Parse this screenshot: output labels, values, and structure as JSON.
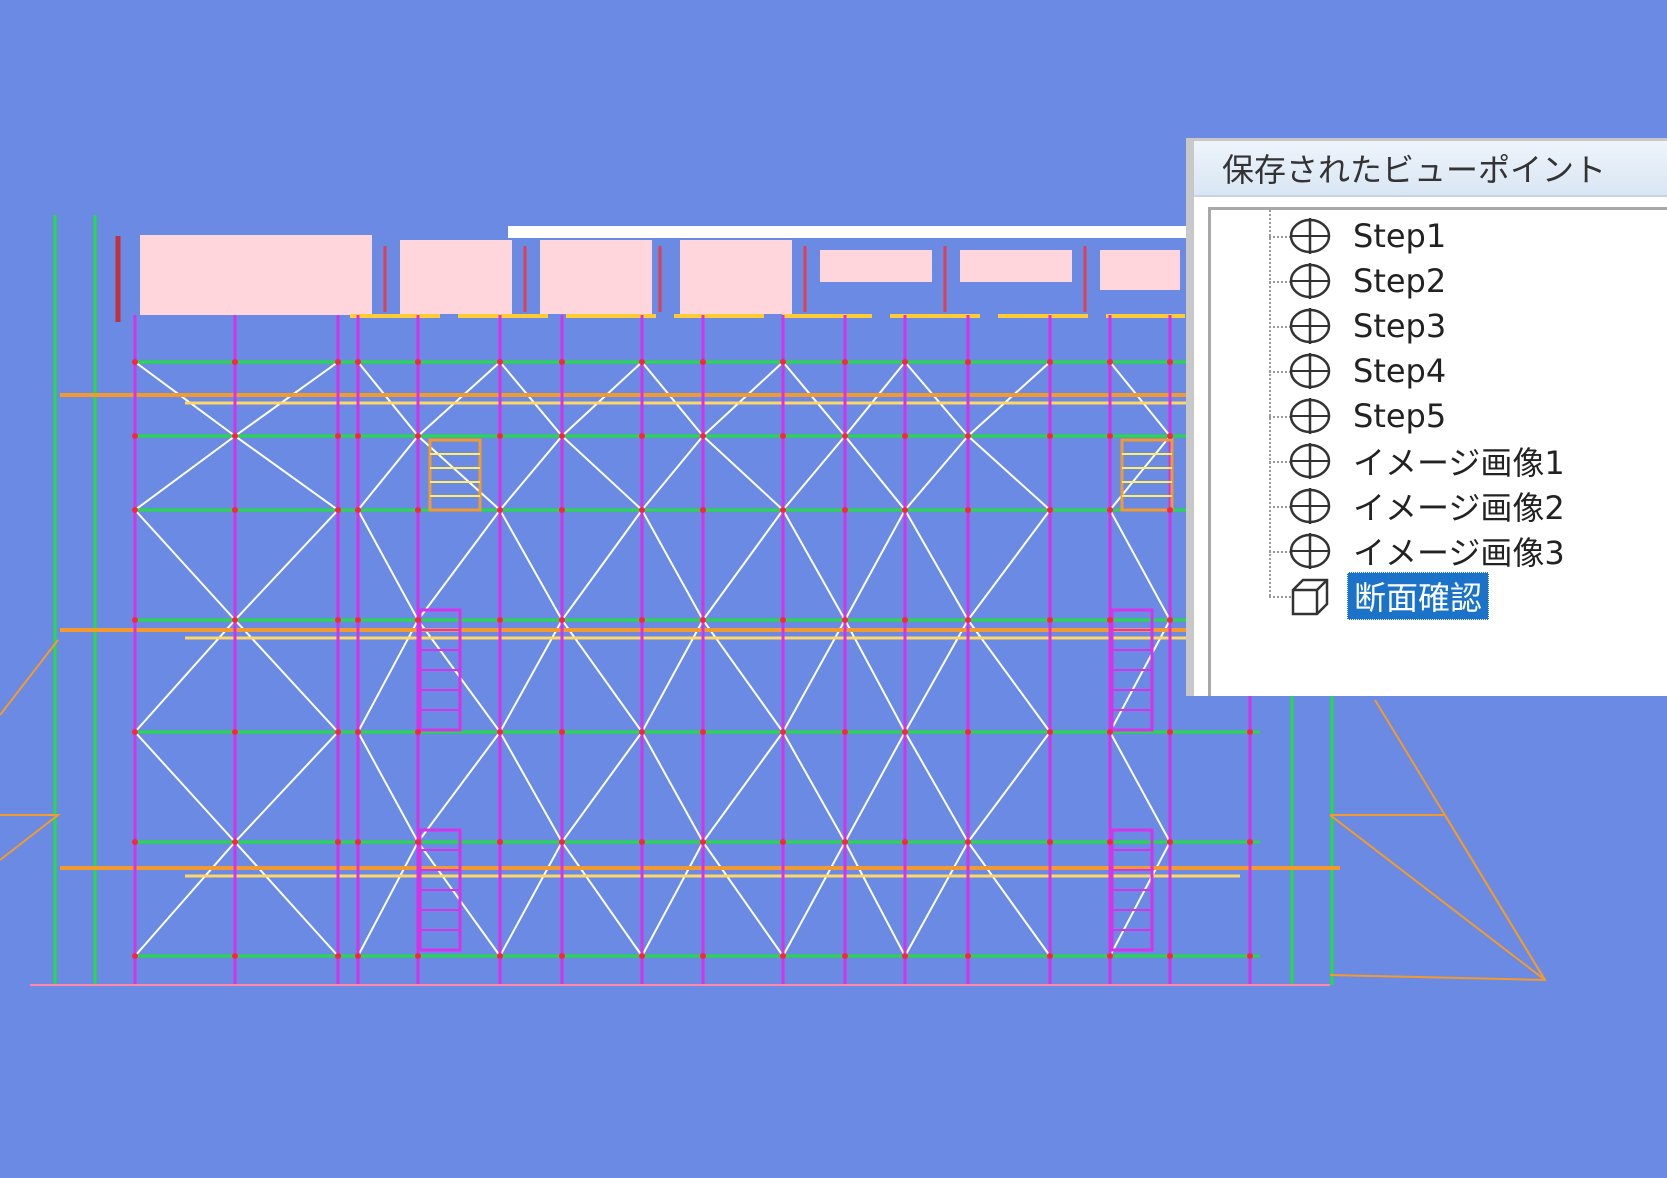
{
  "panel": {
    "title": "保存されたビューポイント",
    "items": [
      {
        "label": "Step1",
        "icon": "viewpoint-icon",
        "selected": false
      },
      {
        "label": "Step2",
        "icon": "viewpoint-icon",
        "selected": false
      },
      {
        "label": "Step3",
        "icon": "viewpoint-icon",
        "selected": false
      },
      {
        "label": "Step4",
        "icon": "viewpoint-icon",
        "selected": false
      },
      {
        "label": "Step5",
        "icon": "viewpoint-icon",
        "selected": false
      },
      {
        "label": "イメージ画像1",
        "icon": "viewpoint-icon",
        "selected": false
      },
      {
        "label": "イメージ画像2",
        "icon": "viewpoint-icon",
        "selected": false
      },
      {
        "label": "イメージ画像3",
        "icon": "viewpoint-icon",
        "selected": false
      },
      {
        "label": "断面確認",
        "icon": "section-box-icon",
        "selected": true
      }
    ]
  },
  "colors": {
    "background": "#6a8ae4",
    "post": "#d633e8",
    "ledger": "#22dd44",
    "brace": "#ffffff",
    "plank": "#f29a2e",
    "beam": "#ffd6dc",
    "selection": "#1a73c9"
  }
}
